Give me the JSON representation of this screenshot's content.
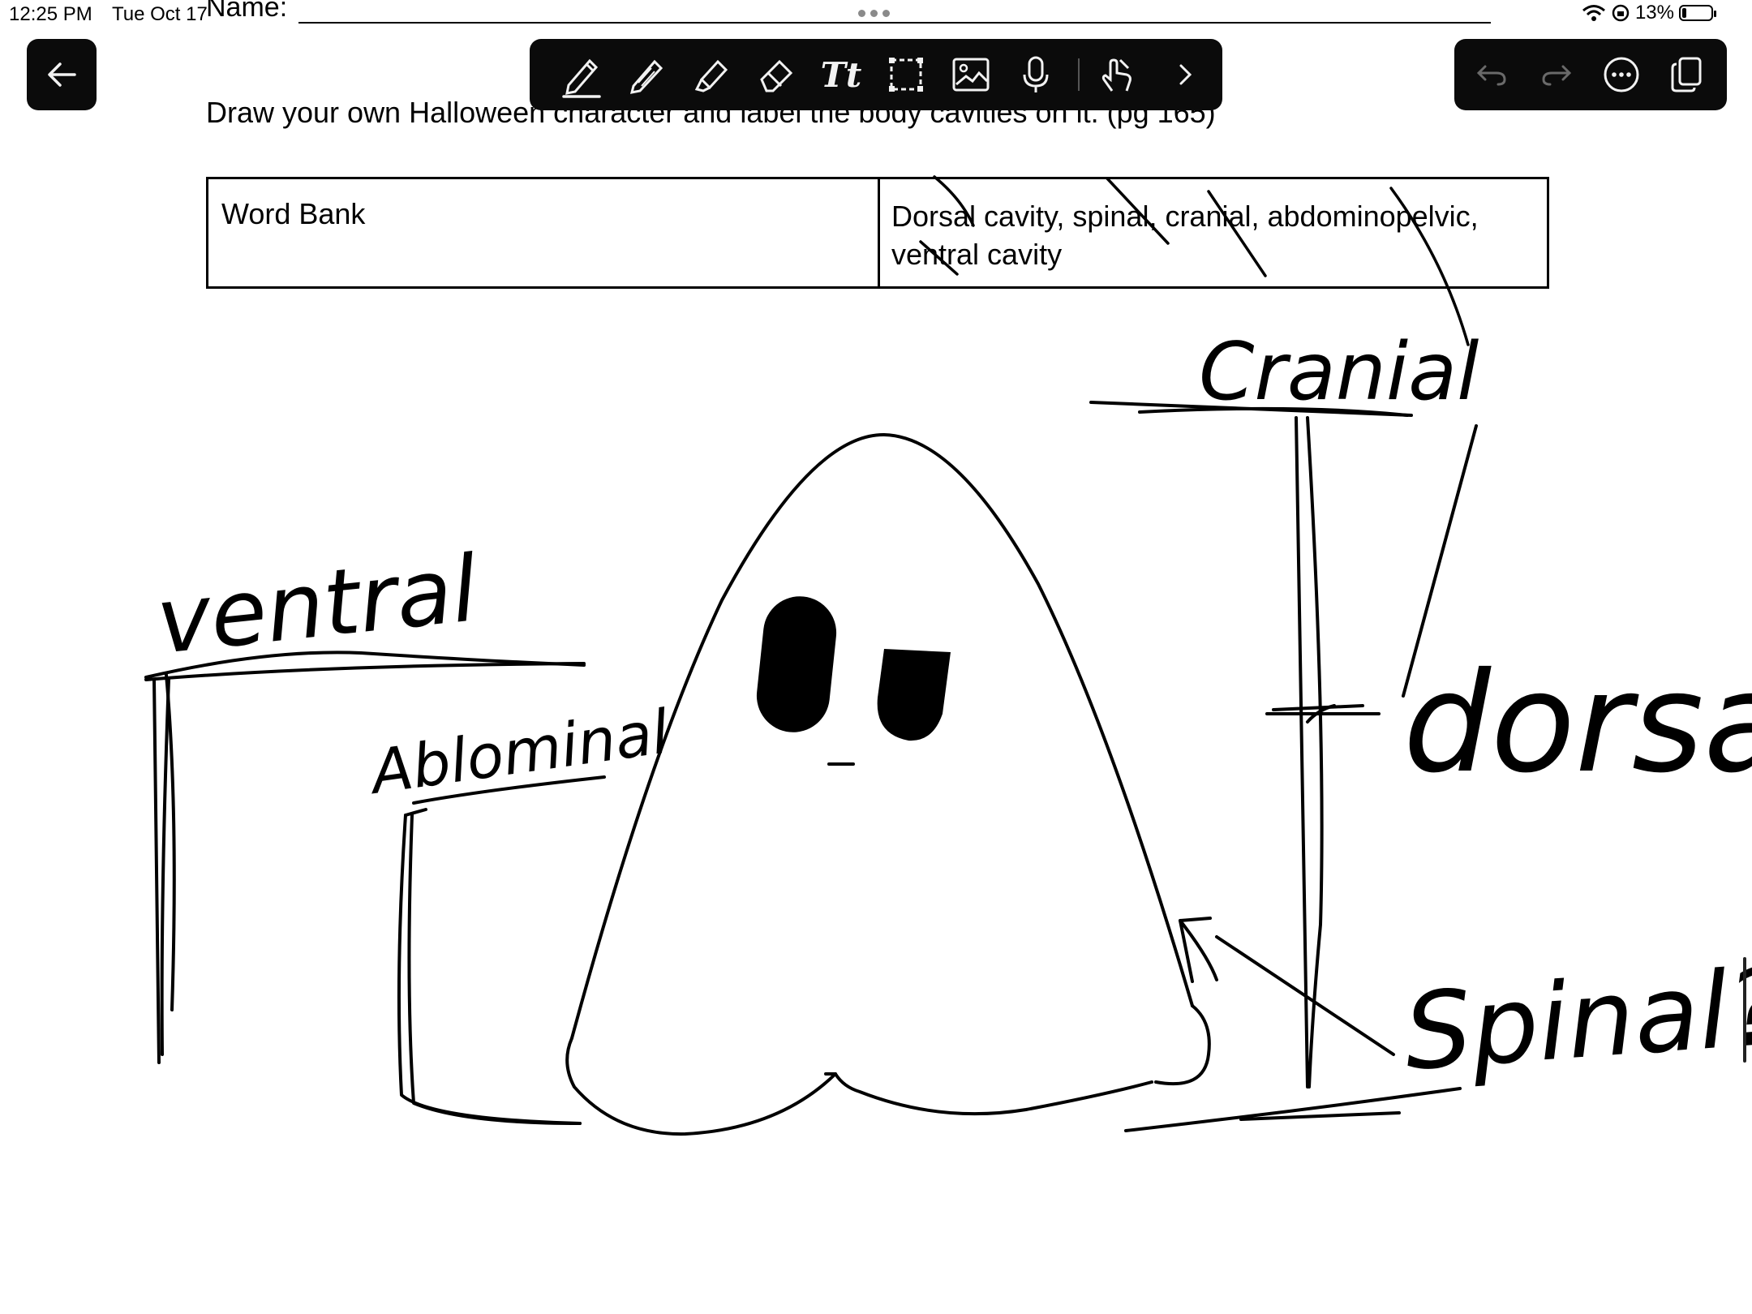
{
  "status_bar": {
    "time": "12:25 PM",
    "date": "Tue Oct 17",
    "battery": "13%"
  },
  "document": {
    "name_label": "Name:",
    "instruction": "Draw your own Halloween character and label the body cavities on it. (pg 165)",
    "word_bank": {
      "label": "Word Bank",
      "words_line1": "Dorsal cavity, spinal, cranial, abdominopelvic,",
      "words_line2": "ventral cavity"
    }
  },
  "toolbar": {
    "tools": [
      "pen-icon",
      "pencil-icon",
      "highlighter-icon",
      "eraser-icon",
      "text-tool-icon",
      "lasso-select-icon",
      "image-icon",
      "microphone-icon",
      "touch-gesture-icon",
      "chevron-right-icon"
    ],
    "text_tool_label": "Tt",
    "active_tool": "pen-icon"
  },
  "right_controls": [
    "undo-icon",
    "redo-icon",
    "more-icon",
    "pages-icon"
  ],
  "handwritten_labels": {
    "ventral": "ventral",
    "abdominal": "Ablominal",
    "cranial": "Cranial",
    "dorsal": "dorsal",
    "spinal": "Spinal?"
  },
  "colors": {
    "toolbar_bg": "#0b0b0b",
    "toolbar_icon": "#f2f2f2",
    "ink": "#000000"
  }
}
